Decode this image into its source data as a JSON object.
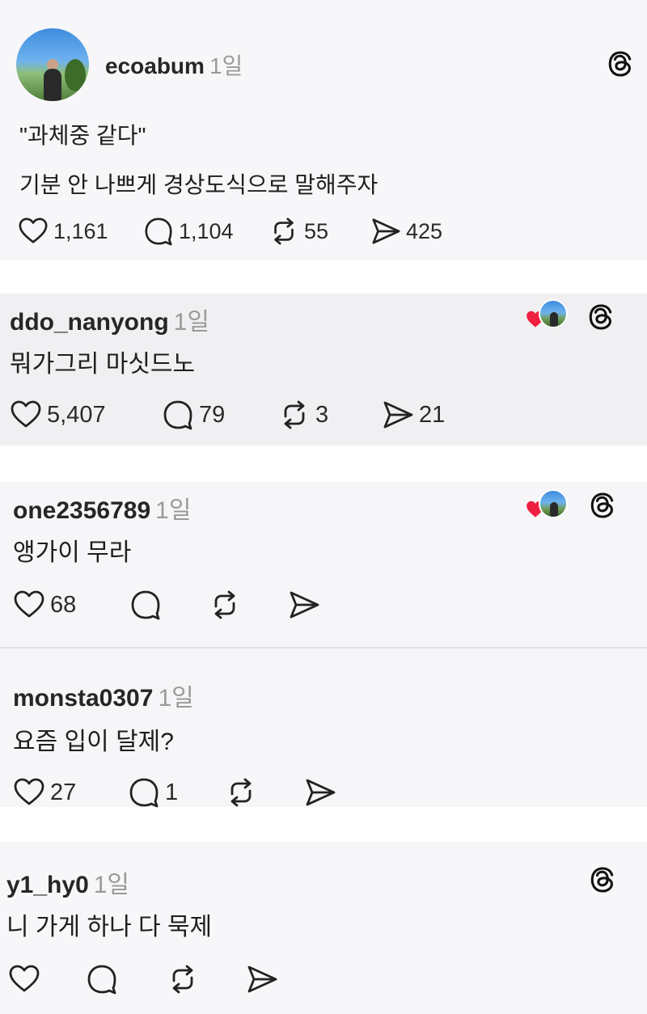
{
  "post": {
    "username": "ecoabum",
    "time": "1일",
    "line1": "\"과체중 같다\"",
    "line2": "기분 안 나쁘게  경상도식으로 말해주자",
    "likes": "1,161",
    "comments": "1,104",
    "reposts": "55",
    "shares": "425"
  },
  "replies": [
    {
      "username": "ddo_nanyong",
      "time": "1일",
      "text": "뭐가그리 마싯드노",
      "likes": "5,407",
      "comments": "79",
      "reposts": "3",
      "shares": "21",
      "liked_by_author": true
    },
    {
      "username": "one2356789",
      "time": "1일",
      "text": "앵가이 무라",
      "likes": "68",
      "comments": "",
      "reposts": "",
      "shares": "",
      "liked_by_author": true
    },
    {
      "username": "monsta0307",
      "time": "1일",
      "text": "요즘 입이 달제?",
      "likes": "27",
      "comments": "1",
      "reposts": "",
      "shares": "",
      "liked_by_author": false
    },
    {
      "username": "y1_hy0",
      "time": "1일",
      "text": "니 가게 하나 다 묵제",
      "likes": "",
      "comments": "",
      "reposts": "",
      "shares": "",
      "liked_by_author": false
    }
  ],
  "icons": {
    "like": "heart-outline-icon",
    "comment": "comment-bubble-icon",
    "repost": "repost-arrows-icon",
    "share": "send-paper-plane-icon",
    "brand": "threads-logo-icon",
    "liked_heart": "red-heart-icon"
  },
  "colors": {
    "liked_heart": "#ef1f3f",
    "timestamp": "#9a9a9a"
  }
}
